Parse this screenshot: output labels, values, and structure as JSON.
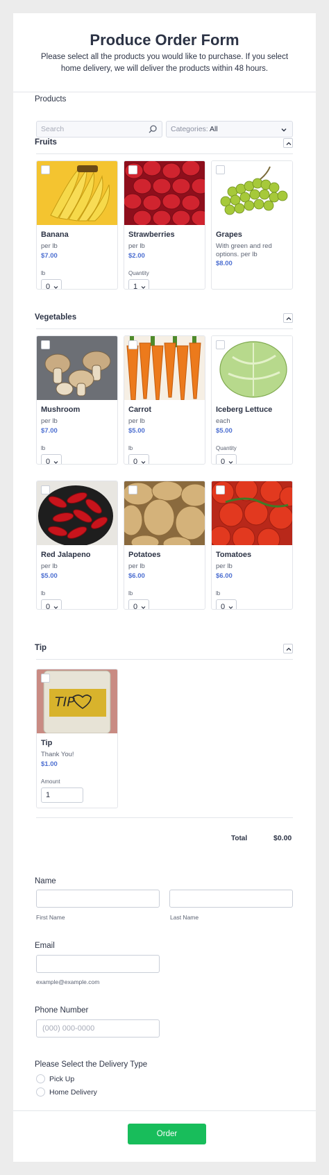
{
  "header": {
    "title": "Produce Order Form",
    "subtitle": "Please select all the products you would like to purchase. If you select home delivery, we will deliver the products within 48 hours."
  },
  "products_section": {
    "label": "Products",
    "search_placeholder": "Search",
    "categories_prefix": "Categories:",
    "categories_value": "All"
  },
  "fruits": {
    "heading": "Fruits",
    "items": [
      {
        "name": "Banana",
        "desc": "per lb",
        "price": "$7.00",
        "qty_label": "lb",
        "qty": "0"
      },
      {
        "name": "Strawberries",
        "desc": "per lb",
        "price": "$2.00",
        "qty_label": "Quantity",
        "qty": "1"
      },
      {
        "name": "Grapes",
        "desc": "With green and red options. per lb",
        "price": "$8.00"
      }
    ]
  },
  "vegetables": {
    "heading": "Vegetables",
    "items": [
      {
        "name": "Mushroom",
        "desc": "per lb",
        "price": "$7.00",
        "qty_label": "lb",
        "qty": "0"
      },
      {
        "name": "Carrot",
        "desc": "per lb",
        "price": "$5.00",
        "qty_label": "lb",
        "qty": "0"
      },
      {
        "name": "Iceberg Lettuce",
        "desc": "each",
        "price": "$5.00",
        "qty_label": "Quantity",
        "qty": "0"
      },
      {
        "name": "Red Jalapeno",
        "desc": "per lb",
        "price": "$5.00",
        "qty_label": "lb",
        "qty": "0"
      },
      {
        "name": "Potatoes",
        "desc": "per lb",
        "price": "$6.00",
        "qty_label": "lb",
        "qty": "0"
      },
      {
        "name": "Tomatoes",
        "desc": "per lb",
        "price": "$6.00",
        "qty_label": "lb",
        "qty": "0"
      }
    ]
  },
  "tip": {
    "heading": "Tip",
    "item": {
      "name": "Tip",
      "desc": "Thank You!",
      "price": "$1.00",
      "amount_label": "Amount",
      "amount": "1",
      "jar_text": "TIP"
    }
  },
  "total": {
    "label": "Total",
    "value": "$0.00"
  },
  "name_field": {
    "label": "Name",
    "first_sub": "First Name",
    "last_sub": "Last Name"
  },
  "email_field": {
    "label": "Email",
    "sub": "example@example.com"
  },
  "phone_field": {
    "label": "Phone Number",
    "placeholder": "(000) 000-0000"
  },
  "delivery": {
    "label": "Please Select the Delivery Type",
    "options": [
      "Pick Up",
      "Home Delivery"
    ]
  },
  "submit": {
    "label": "Order"
  },
  "colors": {
    "accent_green": "#18bd5b",
    "price_blue": "#4d6fd1",
    "page_bg": "#ececec"
  },
  "icons": [
    "search-icon",
    "chevron-down-icon",
    "chevron-up-icon"
  ]
}
